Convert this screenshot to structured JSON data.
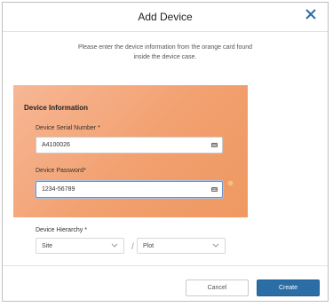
{
  "dialog": {
    "title": "Add Device",
    "intro_line1": "Please enter the device information from the orange card found",
    "intro_line2": "inside the device case."
  },
  "card": {
    "title": "Device Information",
    "serial_label": "Device Serial Number *",
    "serial_value": "A4100026",
    "password_label": "Device Password*",
    "password_value": "1234-56789"
  },
  "hierarchy": {
    "label": "Device Hierarchy *",
    "site_value": "Site",
    "separator": "/",
    "plot_value": "Plot"
  },
  "footer": {
    "cancel_label": "Cancel",
    "create_label": "Create"
  },
  "colors": {
    "accent": "#2b6ea6",
    "card": "#f2a06f"
  }
}
